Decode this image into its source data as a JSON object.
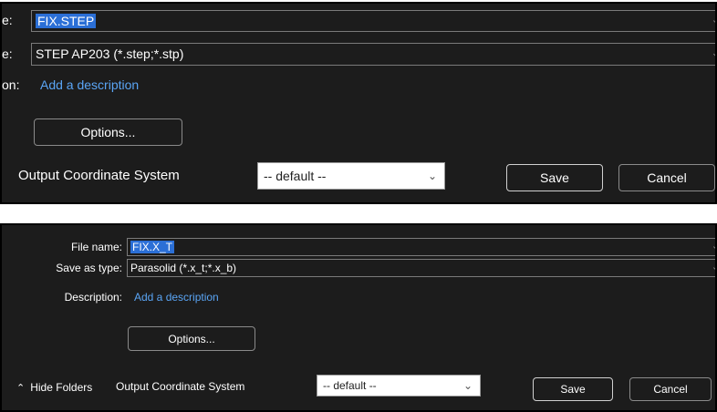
{
  "top_panel": {
    "file_name_label": "e:",
    "file_name_value": "FIX.STEP",
    "save_type_label": "e:",
    "save_type_value": "STEP AP203 (*.step;*.stp)",
    "description_label": "on:",
    "description_link": "Add a description",
    "options_button": "Options...",
    "coord_label": "Output Coordinate System",
    "coord_value": "-- default --",
    "save_button": "Save",
    "cancel_button": "Cancel"
  },
  "bottom_panel": {
    "file_name_label": "File name:",
    "file_name_value": "FIX.X_T",
    "save_type_label": "Save as type:",
    "save_type_value": "Parasolid (*.x_t;*.x_b)",
    "description_label": "Description:",
    "description_link": "Add a description",
    "options_button": "Options...",
    "hide_folders": "Hide Folders",
    "coord_label": "Output Coordinate System",
    "coord_value": "-- default --",
    "save_button": "Save",
    "cancel_button": "Cancel"
  },
  "icons": {
    "dropdown": "chevron-down-icon",
    "hide_folders": "chevron-up-icon"
  },
  "colors": {
    "panel_bg": "#1c1c1c",
    "selection": "#2b6fd6",
    "link": "#5aa5f5"
  }
}
